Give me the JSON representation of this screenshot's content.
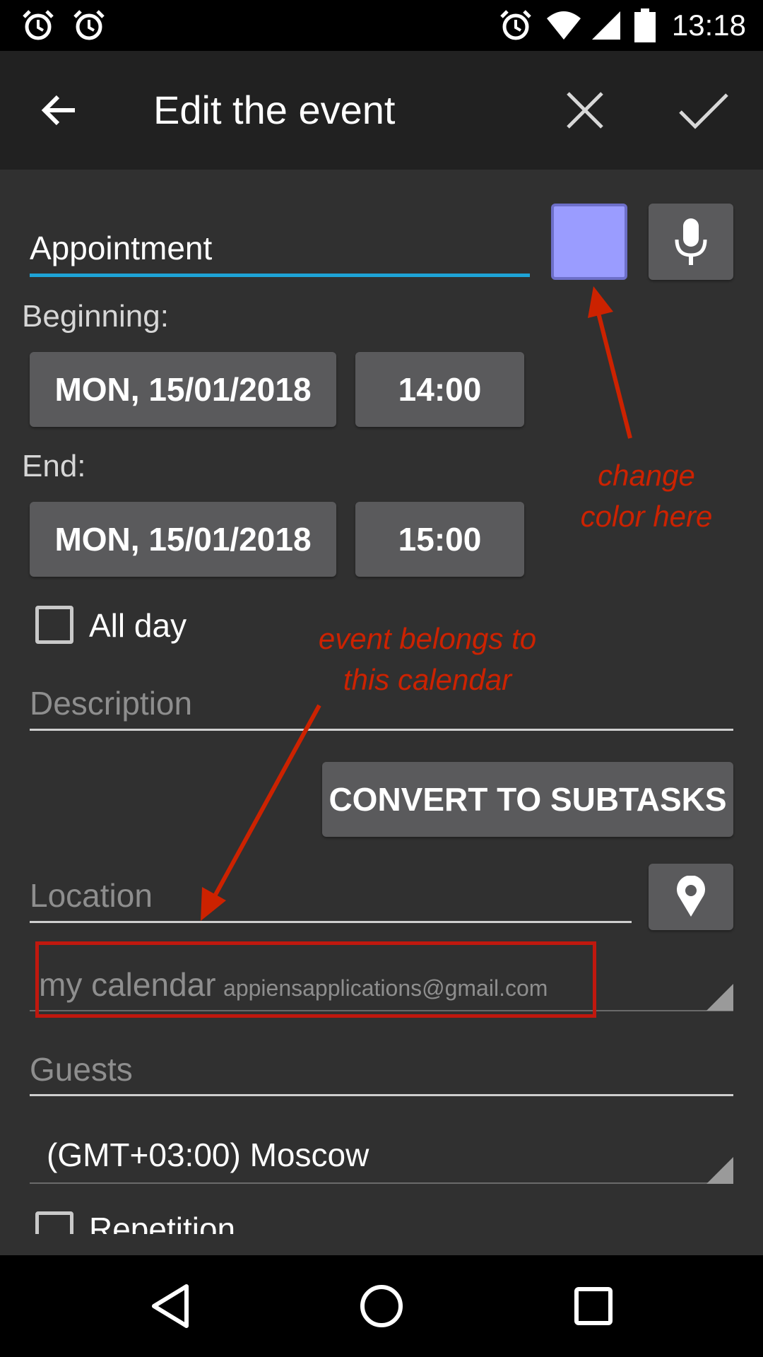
{
  "status_bar": {
    "time": "13:18",
    "left_icons": [
      "alarm-icon",
      "alarm-icon"
    ],
    "right_icons": [
      "alarm-icon",
      "wifi-icon",
      "signal-icon",
      "battery-icon"
    ]
  },
  "app_bar": {
    "title": "Edit the event",
    "back_icon": "arrow-left-icon",
    "cancel_icon": "close-icon",
    "confirm_icon": "check-icon"
  },
  "form": {
    "title_value": "Appointment",
    "color_swatch": "#9a9cff",
    "accent_color": "#1ea3d6",
    "beginning_label": "Beginning:",
    "beginning_date": "MON, 15/01/2018",
    "beginning_time": "14:00",
    "end_label": "End:",
    "end_date": "MON, 15/01/2018",
    "end_time": "15:00",
    "all_day_label": "All day",
    "all_day_checked": false,
    "description_placeholder": "Description",
    "convert_button": "CONVERT TO SUBTASKS",
    "location_placeholder": "Location",
    "calendar_name": "my calendar",
    "calendar_account": "appiensapplications@gmail.com",
    "guests_placeholder": "Guests",
    "timezone": "(GMT+03:00) Moscow",
    "repetition_label": "Repetition"
  },
  "annotations": {
    "color_note_line1": "change",
    "color_note_line2": "color here",
    "calendar_note_line1": "event belongs to",
    "calendar_note_line2": "this calendar",
    "annotation_color": "#cc2200"
  },
  "nav_bar": {
    "icons": [
      "back-triangle-icon",
      "home-circle-icon",
      "recents-square-icon"
    ]
  }
}
